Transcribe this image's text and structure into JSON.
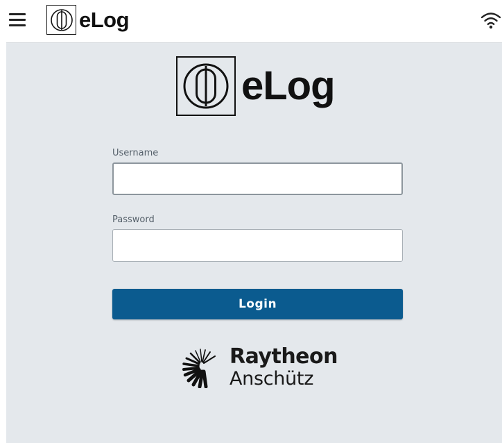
{
  "header": {
    "app_name": "eLog",
    "menu_icon": "hamburger-menu-icon",
    "status_icon": "wifi-icon"
  },
  "login": {
    "logo_text": "eLog",
    "username_label": "Username",
    "username_value": "",
    "password_label": "Password",
    "password_value": "",
    "login_label": "Login"
  },
  "brand": {
    "line1": "Raytheon",
    "line2": "Anschütz"
  },
  "colors": {
    "accent": "#0b5b8f",
    "background": "#e4e8ec",
    "header_bg": "#ffffff"
  }
}
